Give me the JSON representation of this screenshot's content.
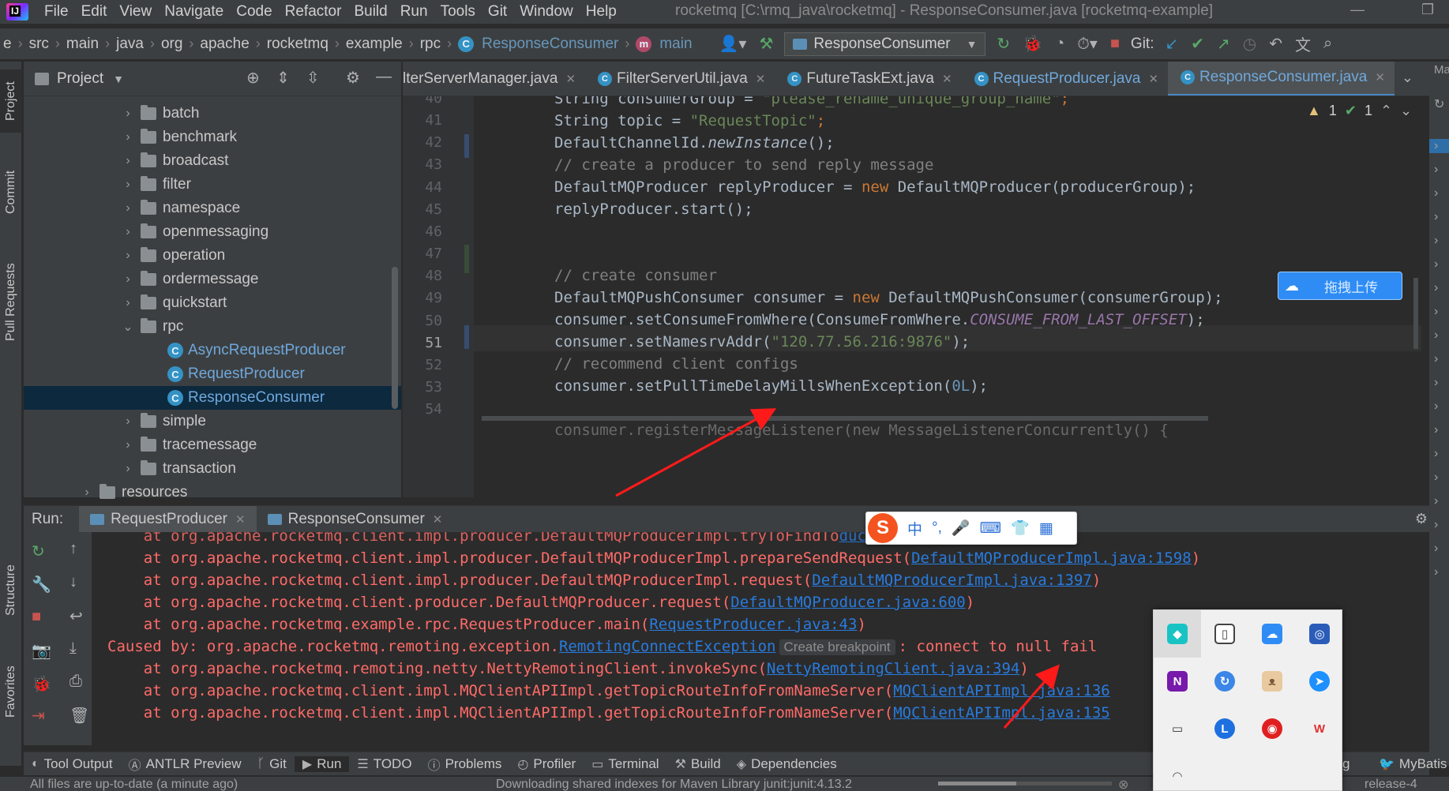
{
  "window": {
    "title": "rocketmq [C:\\rmq_java\\rocketmq] - ResponseConsumer.java [rocketmq-example]",
    "menu": [
      "File",
      "Edit",
      "View",
      "Navigate",
      "Code",
      "Refactor",
      "Build",
      "Run",
      "Tools",
      "Git",
      "Window",
      "Help"
    ]
  },
  "breadcrumb": {
    "items": [
      "e",
      "src",
      "main",
      "java",
      "org",
      "apache",
      "rocketmq",
      "example",
      "rpc",
      "ResponseConsumer",
      "main"
    ]
  },
  "toolbar": {
    "run_config": "ResponseConsumer",
    "git_label": "Git:"
  },
  "left_strip": {
    "tabs": [
      "Project",
      "Commit",
      "Pull Requests",
      "Structure",
      "Favorites"
    ]
  },
  "project": {
    "title": "Project",
    "tree": [
      {
        "label": "batch",
        "type": "folder",
        "expanded": false
      },
      {
        "label": "benchmark",
        "type": "folder",
        "expanded": false
      },
      {
        "label": "broadcast",
        "type": "folder",
        "expanded": false
      },
      {
        "label": "filter",
        "type": "folder",
        "expanded": false
      },
      {
        "label": "namespace",
        "type": "folder",
        "expanded": false
      },
      {
        "label": "openmessaging",
        "type": "folder",
        "expanded": false
      },
      {
        "label": "operation",
        "type": "folder",
        "expanded": false
      },
      {
        "label": "ordermessage",
        "type": "folder",
        "expanded": false
      },
      {
        "label": "quickstart",
        "type": "folder",
        "expanded": false
      },
      {
        "label": "rpc",
        "type": "folder",
        "expanded": true
      },
      {
        "label": "AsyncRequestProducer",
        "type": "class"
      },
      {
        "label": "RequestProducer",
        "type": "class"
      },
      {
        "label": "ResponseConsumer",
        "type": "class",
        "selected": true
      },
      {
        "label": "simple",
        "type": "folder",
        "expanded": false
      },
      {
        "label": "tracemessage",
        "type": "folder",
        "expanded": false
      },
      {
        "label": "transaction",
        "type": "folder",
        "expanded": false
      },
      {
        "label": "resources",
        "type": "resources-folder",
        "expanded": false
      }
    ]
  },
  "editor_tabs": [
    {
      "label": "lterServerManager.java",
      "active": false
    },
    {
      "label": "FilterServerUtil.java",
      "active": false
    },
    {
      "label": "FutureTaskExt.java",
      "active": false
    },
    {
      "label": "RequestProducer.java",
      "active": false
    },
    {
      "label": "ResponseConsumer.java",
      "active": true
    }
  ],
  "editor": {
    "inspections": {
      "warnings": "1",
      "ok": "1"
    },
    "current_line": "51",
    "line_numbers": [
      "40",
      "41",
      "42",
      "43",
      "44",
      "45",
      "46",
      "47",
      "48",
      "49",
      "50",
      "51",
      "52",
      "53",
      "54"
    ],
    "code": {
      "l40": {
        "a": "String consumerGroup = ",
        "b": "\"please_rename_unique_group_name\"",
        "c": ";"
      },
      "l41": {
        "a": "String topic = ",
        "b": "\"RequestTopic\"",
        "c": ";"
      },
      "l42": {
        "a": "DefaultChannelId.",
        "b": "newInstance",
        "c": "();"
      },
      "l43": "// create a producer to send reply message",
      "l44": {
        "a": "DefaultMQProducer replyProducer = ",
        "b": "new",
        "c": " DefaultMQProducer(producerGroup);"
      },
      "l45": "replyProducer.start();",
      "l48": "// create consumer",
      "l49": {
        "a": "DefaultMQPushConsumer consumer = ",
        "b": "new",
        "c": " DefaultMQPushConsumer(consumerGroup);"
      },
      "l50": {
        "a": "consumer.setConsumeFromWhere(ConsumeFromWhere.",
        "b": "CONSUME_FROM_LAST_OFFSET",
        "c": ");"
      },
      "l51": {
        "a": "consumer.setNamesrvAddr(",
        "b": "\"120.77.56.216:9876\"",
        "c": ");"
      },
      "l52": "// recommend client configs",
      "l53": {
        "a": "consumer.setPullTimeDelayMillsWhenException(",
        "b": "0L",
        "c": ");"
      },
      "l54": "consumer.registerMessageListener(new MessageListenerConcurrently() {"
    }
  },
  "cloud_widget": {
    "label": "拖拽上传"
  },
  "run": {
    "label": "Run:",
    "tabs": [
      {
        "label": "RequestProducer",
        "active": true
      },
      {
        "label": "ResponseConsumer",
        "active": false
      }
    ],
    "console": {
      "l0": {
        "text": "    at org.apache.rocketmq.client.impl.producer.DefaultMQProducerImpl.tryToFindTo",
        "link": "ducerImpl.java:707"
      },
      "l1": {
        "text": "    at org.apache.rocketmq.client.impl.producer.DefaultMQProducerImpl.prepareSendRequest(",
        "link": "DefaultMQProducerImpl.java:1598",
        "end": ")"
      },
      "l2": {
        "text": "    at org.apache.rocketmq.client.impl.producer.DefaultMQProducerImpl.request(",
        "link": "DefaultMQProducerImpl.java:1397",
        "end": ")"
      },
      "l3": {
        "text": "    at org.apache.rocketmq.client.producer.DefaultMQProducer.request(",
        "link": "DefaultMQProducer.java:600",
        "end": ")"
      },
      "l4": {
        "text": "    at org.apache.rocketmq.example.rpc.RequestProducer.main(",
        "link": "RequestProducer.java:43",
        "end": ")"
      },
      "l5": {
        "text": "Caused by: org.apache.rocketmq.remoting.exception.",
        "link": "RemotingConnectException",
        "hint": "Create breakpoint",
        "end": ": connect to null fail"
      },
      "l6": {
        "text": "    at org.apache.rocketmq.remoting.netty.NettyRemotingClient.invokeSync(",
        "link": "NettyRemotingClient.java:394",
        "end": ")"
      },
      "l7": {
        "text": "    at org.apache.rocketmq.client.impl.MQClientAPIImpl.getTopicRouteInfoFromNameServer(",
        "link": "MQClientAPIImpl.java:136"
      },
      "l8": {
        "text": "    at org.apache.rocketmq.client.impl.MQClientAPIImpl.getTopicRouteInfoFromNameServer(",
        "link": "MQClientAPIImpl.java:135"
      }
    }
  },
  "ime": {
    "items": [
      "中",
      "°,",
      "🎤",
      "⌨",
      "👕",
      "▦"
    ]
  },
  "bottom_tools": [
    "Tool Output",
    "ANTLR Preview",
    "Git",
    "Run",
    "TODO",
    "Problems",
    "Profiler",
    "Terminal",
    "Build",
    "Dependencies",
    "g",
    "MyBatis"
  ],
  "status": {
    "left": "All files are up-to-date (a minute ago)",
    "middle": "Downloading shared indexes for Maven Library junit:junit:4.13.2",
    "progress": 0.45,
    "right": "release-4"
  },
  "colors": {
    "accent": "#4a88c7",
    "error": "#ff6b68",
    "link": "#287bde",
    "string": "#6a8759",
    "keyword": "#cc7832",
    "annotation_arrow": "#ff1a1a"
  }
}
